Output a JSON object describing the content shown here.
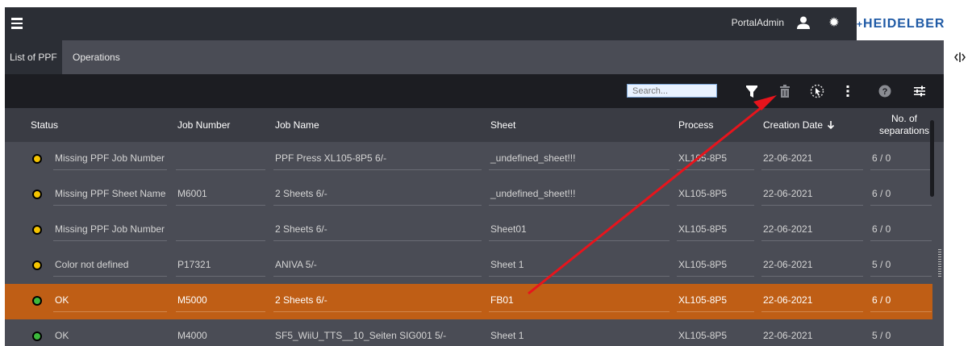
{
  "header": {
    "user_name": "PortalAdmin",
    "brand": "HEIDELBERG"
  },
  "tabs": [
    {
      "label": "List of PPF",
      "active": true
    },
    {
      "label": "Operations",
      "active": false
    }
  ],
  "toolbar": {
    "search_placeholder": "Search...",
    "icons": [
      "filter-icon",
      "delete-icon",
      "select-pointer-icon",
      "more-vertical-icon",
      "help-icon",
      "column-settings-icon"
    ]
  },
  "table": {
    "columns": [
      "Status",
      "Job Number",
      "Job Name",
      "Sheet",
      "Process",
      "Creation Date",
      "No. of separations"
    ],
    "rows": [
      {
        "status_color": "#f5c400",
        "status": "Missing PPF Job Number",
        "job_number": "",
        "job_name": "PPF Press XL105-8P5 6/-",
        "sheet": "_undefined_sheet!!!",
        "process": "XL105-8P5",
        "date": "22-06-2021",
        "separations": "6 / 0",
        "selected": false
      },
      {
        "status_color": "#f5c400",
        "status": "Missing PPF Sheet Name",
        "job_number": "M6001",
        "job_name": "2 Sheets 6/-",
        "sheet": "_undefined_sheet!!!",
        "process": "XL105-8P5",
        "date": "22-06-2021",
        "separations": "6 / 0",
        "selected": false
      },
      {
        "status_color": "#f5c400",
        "status": "Missing PPF Job Number",
        "job_number": "",
        "job_name": "2 Sheets 6/-",
        "sheet": "Sheet01",
        "process": "XL105-8P5",
        "date": "22-06-2021",
        "separations": "6 / 0",
        "selected": false
      },
      {
        "status_color": "#f5c400",
        "status": "Color not defined",
        "job_number": "P17321",
        "job_name": "ANIVA 5/-",
        "sheet": "Sheet 1",
        "process": "XL105-8P5",
        "date": "22-06-2021",
        "separations": "5 / 0",
        "selected": false
      },
      {
        "status_color": "#3cb83c",
        "status": "OK",
        "job_number": "M5000",
        "job_name": "2 Sheets 6/-",
        "sheet": "FB01",
        "process": "XL105-8P5",
        "date": "22-06-2021",
        "separations": "6 / 0",
        "selected": true
      },
      {
        "status_color": "#3cb83c",
        "status": "OK",
        "job_number": "M4000",
        "job_name": "SF5_WiiU_TTS__10_Seiten SIG001 5/-",
        "sheet": "Sheet 1",
        "process": "XL105-8P5",
        "date": "22-06-2021",
        "separations": "5 / 0",
        "selected": false
      }
    ]
  },
  "colors": {
    "accent_selected_row": "#bf5e15",
    "annotation_arrow": "#e8141c"
  }
}
